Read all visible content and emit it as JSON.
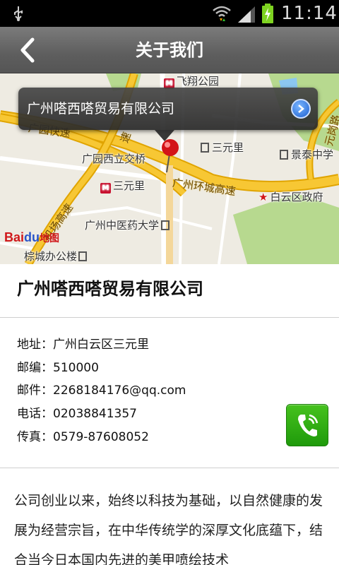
{
  "status_bar": {
    "time": "11:14",
    "icons": [
      "usb-icon",
      "wifi-icon",
      "signal-icon",
      "battery-charging-icon"
    ]
  },
  "header": {
    "title": "关于我们",
    "back_icon": "chevron-left-icon"
  },
  "map": {
    "popup_title": "广州嗒西嗒贸易有限公司",
    "popup_button_icon": "chevron-right-circle-icon",
    "labels": {
      "feixiang_park": "飞翔公园",
      "sanyuanli_building": "三元里",
      "jingtai_school": "景泰中学",
      "guangyuan_interchange": "广园西立交桥",
      "sanyuanli_metro": "三元里",
      "huancheng_expressway": "广州环城高速",
      "baiyun_government": "白云区政府",
      "chinese_medicine_univ": "广州中医药大学",
      "airport_expressway": "机场高速",
      "guangyuan_expressway": "广园快速",
      "yuanguang_road": "元岗路",
      "dingcheng_office": "棕城办公楼",
      "road_partial": "速"
    },
    "logo": {
      "bai": "Bai",
      "du": "du",
      "ditu": "地图"
    },
    "colors": {
      "highway": "#f5b800",
      "water": "#8cc7f0",
      "park": "#b7d98f"
    }
  },
  "company": {
    "name": "广州嗒西嗒贸易有限公司"
  },
  "contact": {
    "address": "地址：广州白云区三元里",
    "postcode": "邮编：510000",
    "email": "邮件：2268184176@qq.com",
    "phone": "电话：02038841357",
    "fax": "传真：0579-87608052",
    "call_icon": "phone-icon",
    "call_color": "#2ea813"
  },
  "description": "公司创业以来，始终以科技为基础，以自然健康的发展为经营宗旨，在中华传统学的深厚文化底蕴下，结合当今日本国内先进的美甲喷绘技术"
}
